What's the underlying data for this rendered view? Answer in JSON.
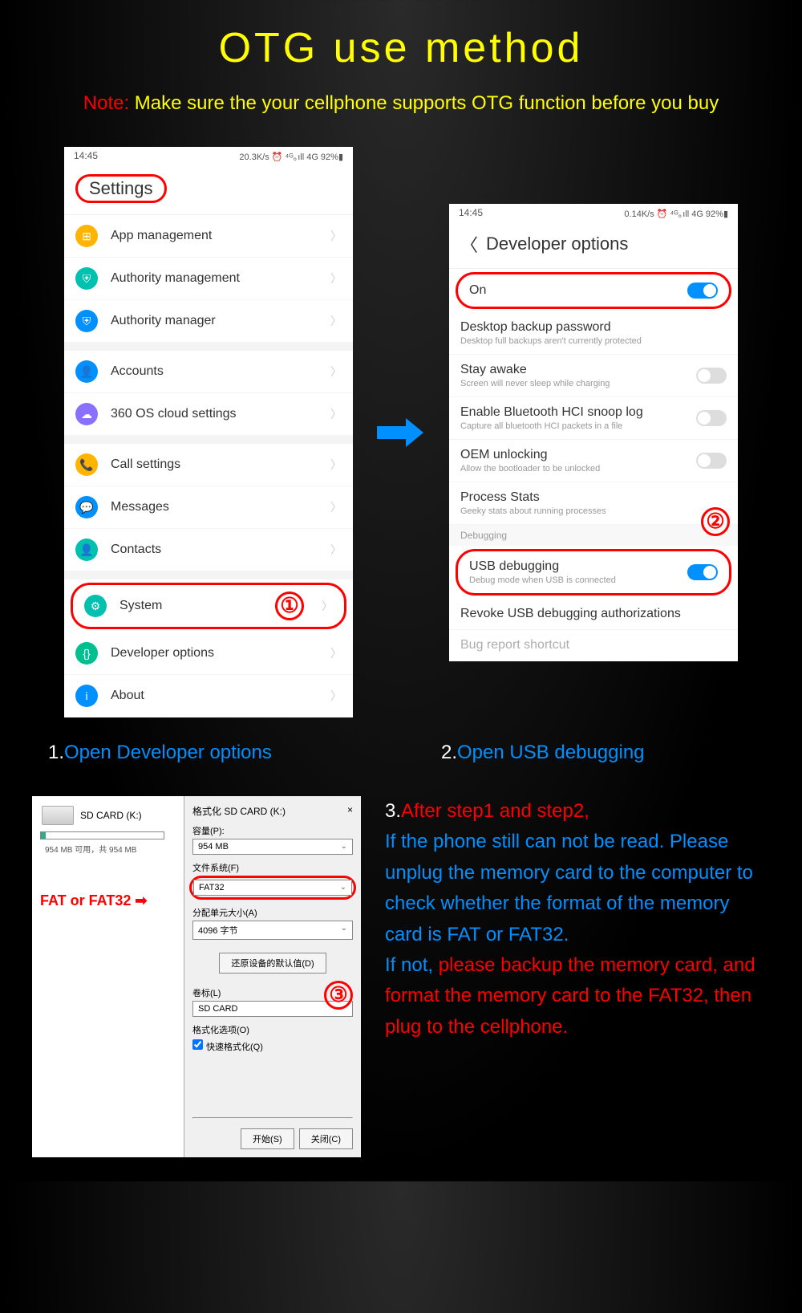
{
  "title": "OTG use method",
  "note_label": "Note:",
  "note_text": " Make sure the your cellphone supports OTG function before you buy",
  "phone1": {
    "time": "14:45",
    "status": "20.3K/s ⏰ ⁴ᴳ｡ıll 4G 92%▮",
    "header": "Settings",
    "items": [
      {
        "icon": "⊞",
        "color": "#ffb400",
        "label": "App management",
        "name": "app-management"
      },
      {
        "icon": "⛨",
        "color": "#00c0b0",
        "label": "Authority management",
        "name": "authority-management"
      },
      {
        "icon": "⛨",
        "color": "#0090ff",
        "label": "Authority manager",
        "name": "authority-manager"
      }
    ],
    "items2": [
      {
        "icon": "👤",
        "color": "#0090ff",
        "label": "Accounts",
        "name": "accounts"
      },
      {
        "icon": "☁",
        "color": "#8a70ff",
        "label": "360 OS cloud settings",
        "name": "cloud-settings"
      }
    ],
    "items3": [
      {
        "icon": "📞",
        "color": "#ffb400",
        "label": "Call settings",
        "name": "call-settings"
      },
      {
        "icon": "💬",
        "color": "#0090ff",
        "label": "Messages",
        "name": "messages"
      },
      {
        "icon": "👤",
        "color": "#00c0b0",
        "label": "Contacts",
        "name": "contacts"
      }
    ],
    "system": {
      "icon": "⚙",
      "color": "#00c0b0",
      "label": "System"
    },
    "items4": [
      {
        "icon": "{}",
        "color": "#00c090",
        "label": "Developer options",
        "name": "developer-options"
      },
      {
        "icon": "i",
        "color": "#0090ff",
        "label": "About",
        "name": "about"
      }
    ],
    "badge1": "①"
  },
  "phone2": {
    "time": "14:45",
    "status": "0.14K/s ⏰ ⁴ᴳ｡ıll 4G 92%▮",
    "header": "Developer options",
    "on": "On",
    "items": [
      {
        "main": "Desktop backup password",
        "sub": "Desktop full backups aren't currently protected",
        "name": "desktop-backup"
      },
      {
        "main": "Stay awake",
        "sub": "Screen will never sleep while charging",
        "toggle": false,
        "name": "stay-awake"
      },
      {
        "main": "Enable Bluetooth HCI snoop log",
        "sub": "Capture all bluetooth HCI packets in a file",
        "toggle": false,
        "name": "bt-snoop"
      },
      {
        "main": "OEM unlocking",
        "sub": "Allow the bootloader to be unlocked",
        "toggle": false,
        "name": "oem-unlock"
      },
      {
        "main": "Process Stats",
        "sub": "Geeky stats about running processes",
        "name": "process-stats"
      }
    ],
    "debug_section": "Debugging",
    "usb": {
      "main": "USB debugging",
      "sub": "Debug mode when USB is connected"
    },
    "items2": [
      {
        "main": "Revoke USB debugging authorizations",
        "name": "revoke-usb"
      },
      {
        "main": "Bug report shortcut",
        "name": "bug-report",
        "faded": true
      }
    ],
    "badge2": "②"
  },
  "cap1_num": "1.",
  "cap1_txt": "Open Developer options",
  "cap2_num": "2.",
  "cap2_txt": "Open USB debugging",
  "format": {
    "drive_label": "SD CARD (K:)",
    "drive_sub": "954 MB 可用，共 954 MB",
    "title": "格式化 SD CARD (K:)",
    "close": "×",
    "cap_label": "容量(P):",
    "cap_val": "954 MB",
    "fs_label": "文件系统(F)",
    "fs_val": "FAT32",
    "au_label": "分配单元大小(A)",
    "au_val": "4096 字节",
    "restore_btn": "还原设备的默认值(D)",
    "vol_label": "卷标(L)",
    "vol_val": "SD CARD",
    "opt_label": "格式化选项(O)",
    "quick": "快速格式化(Q)",
    "start": "开始(S)",
    "closebtn": "关闭(C)",
    "note": "FAT or FAT32  ➡",
    "badge3": "③"
  },
  "step3": {
    "num": "3.",
    "p1": "After step1 and step2,",
    "p2": "If the phone still can not be read. Please unplug the memory card to the computer to check whether the format of the memory card is FAT or FAT32.",
    "p3a": "If not, ",
    "p3b": "please backup the memory card, and format the memory card to the FAT32, then plug to the cellphone."
  }
}
